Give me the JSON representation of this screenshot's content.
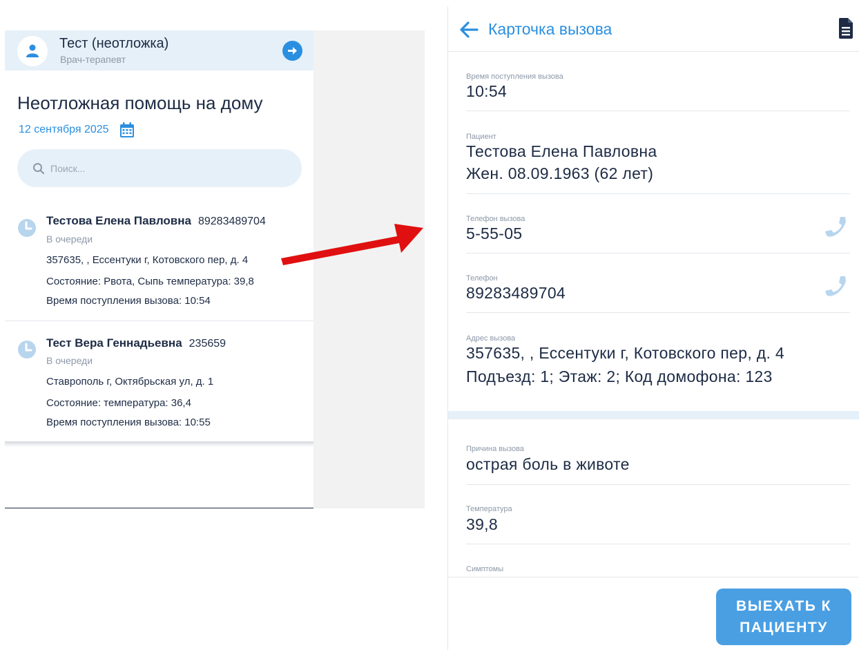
{
  "left": {
    "user": {
      "name": "Тест (неотложка)",
      "role": "Врач-терапевт"
    },
    "heading": "Неотложная помощь на дому",
    "date": "12 сентября 2025",
    "search_placeholder": "Поиск...",
    "calls": [
      {
        "name": "Тестова Елена Павловна",
        "phone": "89283489704",
        "status": "В очереди",
        "address": "357635, , Ессентуки г, Котовского пер, д. 4",
        "condition": "Состояние:  Рвота, Сыпь  температура: 39,8",
        "time": "Время поступления вызова: 10:54"
      },
      {
        "name": "Тест Вера Геннадьевна",
        "phone": "235659",
        "status": "В очереди",
        "address": "Ставрополь г, Октябрьская ул, д. 1",
        "condition": "Состояние:    температура: 36,4",
        "time": "Время поступления вызова: 10:55"
      }
    ]
  },
  "right": {
    "title": "Карточка вызова",
    "fields": {
      "call_time": {
        "label": "Время поступления вызова",
        "value": "10:54"
      },
      "patient": {
        "label": "Пациент",
        "line1": "Тестова Елена Павловна",
        "line2": "Жен. 08.09.1963 (62 лет)"
      },
      "call_phone": {
        "label": "Телефон вызова",
        "value": "5-55-05"
      },
      "phone": {
        "label": "Телефон",
        "value": "89283489704"
      },
      "address": {
        "label": "Адрес вызова",
        "line1": "357635, , Ессентуки г, Котовского пер, д. 4",
        "line2": "Подъезд: 1; Этаж: 2; Код домофона: 123"
      },
      "reason": {
        "label": "Причина вызова",
        "value": "острая боль в животе"
      },
      "temperature": {
        "label": "Температура",
        "value": "39,8"
      },
      "symptoms": {
        "label": "Симптомы"
      }
    },
    "depart_button": {
      "line1": "ВЫЕХАТЬ К",
      "line2": "ПАЦИЕНТУ"
    }
  },
  "colors": {
    "accent": "#2a8fe0",
    "header_bg": "#e6f0f8",
    "text_dark": "#1d2b45",
    "text_muted": "#8c98a8",
    "arrow": "#e01010",
    "button": "#4a9fe3",
    "icon_light": "#b8d5ee"
  },
  "icons": {
    "avatar": "person-icon",
    "logout": "arrow-right-circle-icon",
    "calendar": "calendar-icon",
    "search": "search-icon",
    "status": "clock-icon",
    "back": "arrow-left-icon",
    "document": "document-icon",
    "phone": "phone-icon"
  }
}
